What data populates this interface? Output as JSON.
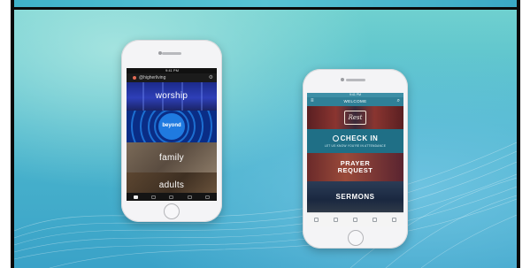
{
  "colors": {
    "background_teal": "#4cb7cd",
    "worship_blue": "#2e3fb8",
    "beyond_blue": "#1f7ae0",
    "checkin_teal": "#1f6f86",
    "prayer_red": "#9a4a3a",
    "sermons_navy": "#1a2840"
  },
  "phone_left": {
    "status_time": "9:41 PM",
    "header_handle": "@higherliving",
    "tiles": [
      {
        "label": "worship"
      },
      {
        "label": "beyond"
      },
      {
        "label": "family"
      },
      {
        "label": "adults"
      }
    ],
    "nav_icons": [
      "home-icon",
      "events-icon",
      "giving-icon",
      "connect-icon",
      "more-icon"
    ]
  },
  "phone_right": {
    "status_time": "9:41 PM",
    "header_title": "WELCOME",
    "logo_text": "Rest",
    "checkin_title": "CHECK IN",
    "checkin_subtitle": "LET US KNOW YOU'RE IN ATTENDANCE",
    "prayer_label_1": "PRAYER",
    "prayer_label_2": "REQUEST",
    "sermons_label": "SERMONS",
    "nav_icons": [
      "welcome-icon",
      "media-icon",
      "events-icon",
      "giving-icon",
      "more-icon"
    ]
  }
}
